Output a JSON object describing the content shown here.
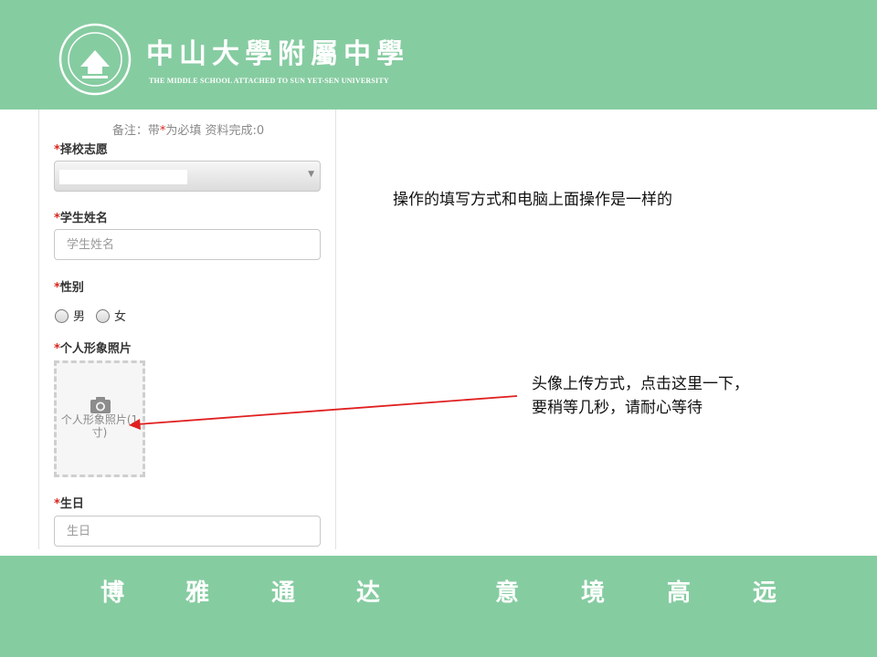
{
  "header": {
    "school_name": "中山大學附屬中學",
    "school_name_en": "THE MIDDLE SCHOOL ATTACHED TO SUN YET-SEN UNIVERSITY",
    "background_color": "#86cca1"
  },
  "form": {
    "note": {
      "prefix": "备注：带",
      "star": "*",
      "suffix": "为必填 资料完成:0"
    },
    "required_mark": "*",
    "school_choice": {
      "label": "择校志愿",
      "value": ""
    },
    "student_name": {
      "label": "学生姓名",
      "placeholder": "学生姓名",
      "value": ""
    },
    "gender": {
      "label": "性别",
      "options": [
        "男",
        "女"
      ]
    },
    "photo": {
      "label": "个人形象照片",
      "upload_text": "个人形象照片(1寸)"
    },
    "birthday": {
      "label": "生日",
      "placeholder": "生日",
      "value": ""
    }
  },
  "instructions": {
    "general": "操作的填写方式和电脑上面操作是一样的",
    "photo_line1": "头像上传方式，点击这里一下，",
    "photo_line2": "要稍等几秒，请耐心等待"
  },
  "footer": {
    "motto": [
      "博",
      "雅",
      "通",
      "达",
      "意",
      "境",
      "高",
      "远"
    ]
  },
  "colors": {
    "accent_green": "#86cca1",
    "required_red": "#d9251c",
    "arrow_red": "#e02020"
  },
  "icons": [
    "school-emblem-icon",
    "camera-icon",
    "dropdown-arrow-icon"
  ]
}
